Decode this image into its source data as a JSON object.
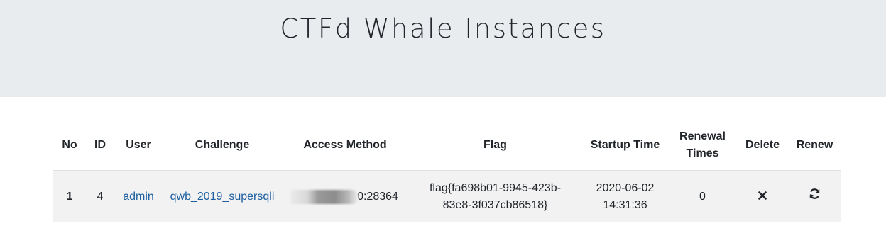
{
  "page": {
    "title": "CTFd Whale Instances"
  },
  "table": {
    "headers": {
      "no": "No",
      "id": "ID",
      "user": "User",
      "challenge": "Challenge",
      "access_method": "Access Method",
      "flag": "Flag",
      "startup_time": "Startup Time",
      "renewal_times_line1": "Renewal",
      "renewal_times_line2": "Times",
      "delete": "Delete",
      "renew": "Renew"
    },
    "rows": [
      {
        "no": "1",
        "id": "4",
        "user": "admin",
        "challenge": "qwb_2019_supersqli",
        "access_method_visible": "0:28364",
        "flag_line1": "flag{fa698b01-9945-423b-",
        "flag_line2": "83e8-3f037cb86518}",
        "startup_date": "2020-06-02",
        "startup_clock": "14:31:36",
        "renewal_times": "0",
        "delete_icon": "times-icon",
        "renew_icon": "sync-icon"
      }
    ]
  }
}
